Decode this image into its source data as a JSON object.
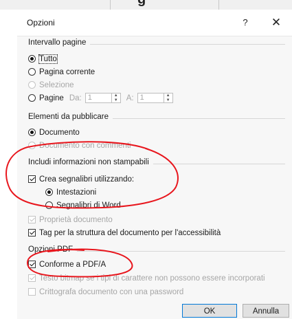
{
  "dialog": {
    "title": "Opzioni",
    "help_label": "?",
    "close_label": "✕"
  },
  "page_range": {
    "label": "Intervallo pagine",
    "all": "Tutto",
    "current": "Pagina corrente",
    "selection": "Selezione",
    "pages": "Pagine",
    "from_label": "Da:",
    "from_value": "1",
    "to_label": "A:",
    "to_value": "1"
  },
  "publish": {
    "label": "Elementi da pubblicare",
    "document": "Documento",
    "document_markup": "Documento con commenti"
  },
  "nonprint": {
    "label": "Includi informazioni non stampabili",
    "bookmarks": "Crea segnalibri utilizzando:",
    "headings": "Intestazioni",
    "word_bookmarks": "Segnalibri di Word",
    "properties": "Proprietà documento",
    "tags": "Tag per la struttura del documento per l'accessibilità"
  },
  "pdf": {
    "label": "Opzioni PDF",
    "pdfa": "Conforme a PDF/A",
    "bitmap": "Testo bitmap se i tipi di carattere non possono essere incorporati",
    "encrypt": "Crittografa documento con una password"
  },
  "buttons": {
    "ok": "OK",
    "cancel": "Annulla"
  },
  "annotation_color": "#e8161d"
}
